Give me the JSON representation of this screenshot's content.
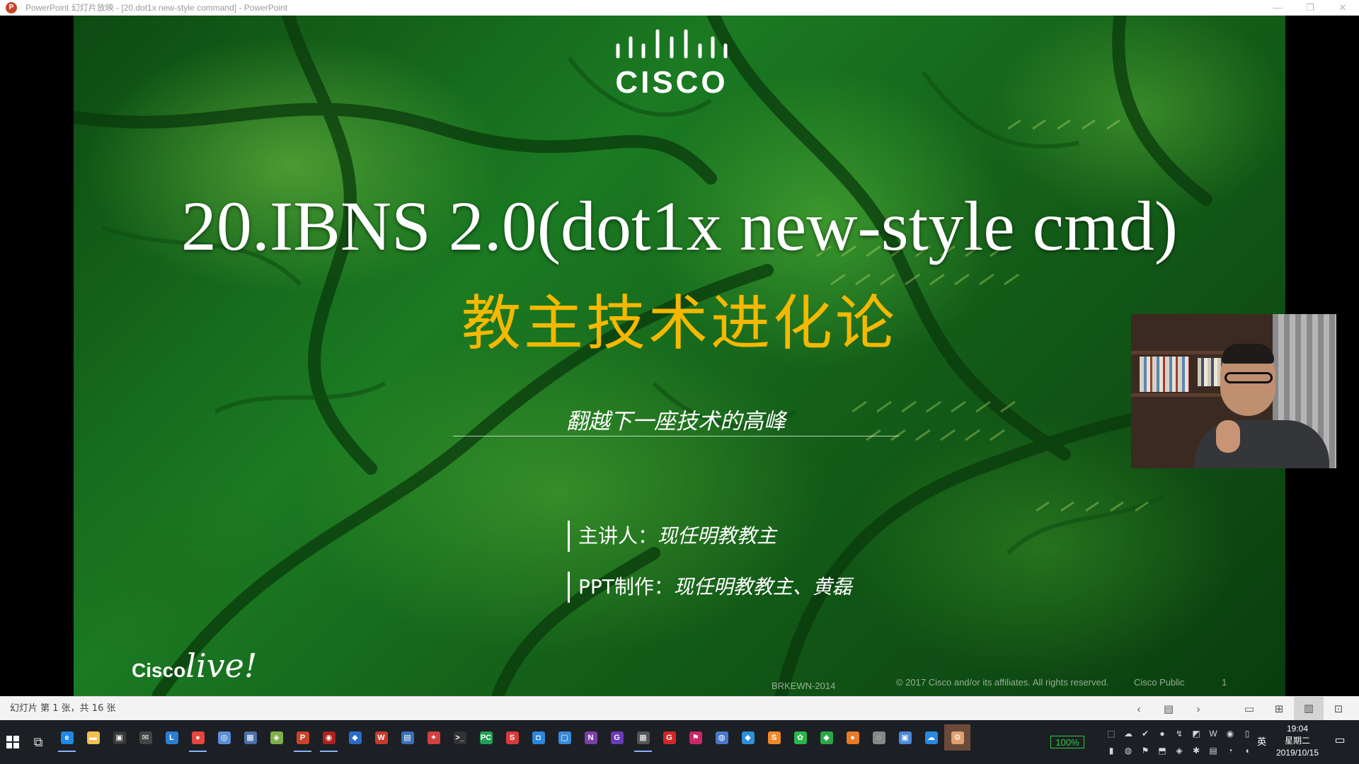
{
  "window": {
    "title": "PowerPoint 幻灯片放映 - [20.dot1x new-style command] - PowerPoint",
    "app_icon": "P",
    "min_glyph": "—",
    "restore_glyph": "❐",
    "close_glyph": "✕"
  },
  "slide": {
    "logo_text": "CISCO",
    "title": "20.IBNS 2.0(dot1x new-style cmd)",
    "subtitle": "教主技术进化论",
    "tagline": "翻越下一座技术的高峰",
    "presenter_label": "主讲人：",
    "presenter_name": "现任明教教主",
    "ppt_label": "PPT制作：",
    "ppt_names": "现任明教教主、黄磊",
    "event_logo_a": "Cisco",
    "event_logo_b": "live!",
    "session_code": "BRKEWN-2014",
    "legal": "© 2017  Cisco and/or its affiliates. All rights reserved.",
    "classification": "Cisco Public",
    "page_number": "1",
    "colors": {
      "title": "#ffffff",
      "subtitle": "#f5b800",
      "background": "#1b7a22"
    }
  },
  "status_bar": {
    "slide_counter": "幻灯片 第 1 张，共 16 张",
    "icons": [
      "prev-arrow-icon",
      "notes-icon",
      "next-arrow-icon",
      "normal-view-icon",
      "slide-sorter-icon",
      "reading-view-icon",
      "slideshow-icon"
    ],
    "glyphs": {
      "prev": "‹",
      "notes": "▤",
      "next": "›",
      "normal": "▭",
      "sorter": "⊞",
      "reading": "▥",
      "show": "⊡"
    }
  },
  "taskbar": {
    "tasks_glyph": "⧉",
    "apps": [
      {
        "name": "edge",
        "glyph": "e",
        "color": "#1e88e5"
      },
      {
        "name": "file-explorer",
        "glyph": "▬",
        "color": "#f2c14e"
      },
      {
        "name": "store",
        "glyph": "▣",
        "color": "#3a3a3a"
      },
      {
        "name": "mail",
        "glyph": "✉",
        "color": "#444"
      },
      {
        "name": "app-l",
        "glyph": "L",
        "color": "#2a7fd4"
      },
      {
        "name": "chrome",
        "glyph": "●",
        "color": "#e8453c"
      },
      {
        "name": "network-app",
        "glyph": "◎",
        "color": "#5a8fd8"
      },
      {
        "name": "network-tool",
        "glyph": "▦",
        "color": "#4a6fa8"
      },
      {
        "name": "diagram-tool",
        "glyph": "◈",
        "color": "#7fb04a"
      },
      {
        "name": "powerpoint",
        "glyph": "P",
        "color": "#c8442a"
      },
      {
        "name": "recorder",
        "glyph": "◉",
        "color": "#b02020"
      },
      {
        "name": "shield-app",
        "glyph": "◆",
        "color": "#2a6cc8"
      },
      {
        "name": "wps",
        "glyph": "W",
        "color": "#c83a2a"
      },
      {
        "name": "remote-desktop",
        "glyph": "▤",
        "color": "#3a6fb8"
      },
      {
        "name": "pin-app",
        "glyph": "✦",
        "color": "#d04040"
      },
      {
        "name": "terminal",
        "glyph": ">_",
        "color": "#333"
      },
      {
        "name": "pycharm",
        "glyph": "PC",
        "color": "#21a055"
      },
      {
        "name": "red-app",
        "glyph": "S",
        "color": "#d83a3a"
      },
      {
        "name": "blue-app",
        "glyph": "◘",
        "color": "#2a88e0"
      },
      {
        "name": "blue-app-2",
        "glyph": "▢",
        "color": "#3a8ad8"
      },
      {
        "name": "onenote",
        "glyph": "N",
        "color": "#7b3fa8"
      },
      {
        "name": "purple-app",
        "glyph": "G",
        "color": "#6a3ab8"
      },
      {
        "name": "calculator",
        "glyph": "▦",
        "color": "#555"
      },
      {
        "name": "red-tool",
        "glyph": "G",
        "color": "#d02828"
      },
      {
        "name": "flag-app",
        "glyph": "⚑",
        "color": "#c8286a"
      },
      {
        "name": "globe-app",
        "glyph": "◍",
        "color": "#4a78c8"
      },
      {
        "name": "blue-tool",
        "glyph": "◆",
        "color": "#2a90d8"
      },
      {
        "name": "sublime",
        "glyph": "S",
        "color": "#f08a28"
      },
      {
        "name": "wechat",
        "glyph": "✿",
        "color": "#2ab84a"
      },
      {
        "name": "green-app",
        "glyph": "◆",
        "color": "#2aa84a"
      },
      {
        "name": "firefox",
        "glyph": "●",
        "color": "#e87a28"
      },
      {
        "name": "circle-app",
        "glyph": "◌",
        "color": "#888"
      },
      {
        "name": "screen-app",
        "glyph": "▣",
        "color": "#4a8ad8"
      },
      {
        "name": "cloud-app",
        "glyph": "☁",
        "color": "#2a88e0"
      },
      {
        "name": "active-app",
        "glyph": "⚙",
        "color": "#e0a070"
      }
    ],
    "battery": "100%",
    "tray_icons": [
      "⬚",
      "☁",
      "✔",
      "●",
      "↯",
      "◩",
      "W",
      "◉",
      "▯",
      "▮",
      "◍",
      "⚑",
      "⬒",
      "◈",
      "✱",
      "▤",
      "◔",
      "◖"
    ],
    "ime": "英",
    "time": "19:04",
    "weekday": "星期二",
    "date": "2019/10/15",
    "notif_glyph": "▭"
  }
}
